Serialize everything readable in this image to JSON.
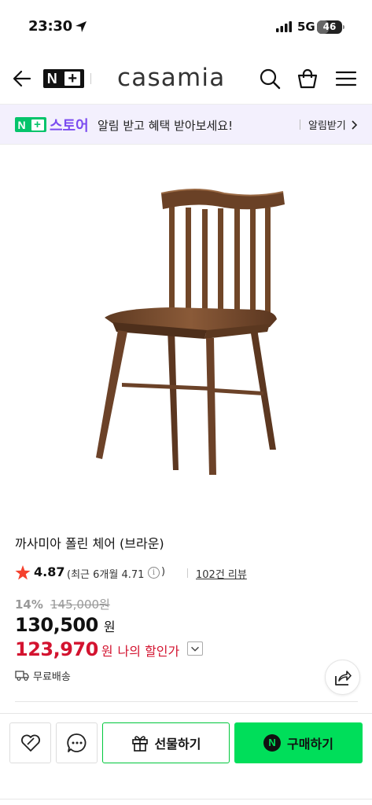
{
  "status_bar": {
    "time": "23:30",
    "network": "5G",
    "battery": "46",
    "battery_level_percent": 46
  },
  "header": {
    "logo_n": "N",
    "logo_plus": "+",
    "brand": "casamia",
    "icons": [
      "back-arrow-icon",
      "search-icon",
      "shopping-bag-icon",
      "menu-icon"
    ]
  },
  "promo": {
    "badge_n": "N",
    "badge_plus": "+",
    "store": "스토어",
    "text": "알림 받고 혜택 받아보세요!",
    "link": "알림받기"
  },
  "product": {
    "title": "까사미아 폴린 체어 (브라운)",
    "rating": "4.87",
    "recent_rating": "(최근 6개월 4.71",
    "recent_close": ")",
    "reviews": "102건 리뷰",
    "discount": "14%",
    "original_price": "145,000원",
    "price": "130,500",
    "price_unit": "원",
    "my_price": "123,970",
    "my_price_unit": "원",
    "my_price_label": "나의 할인가",
    "shipping": "무료배송"
  },
  "bottom_bar": {
    "gift_label": "선물하기",
    "buy_n": "N",
    "buy_label": "구매하기"
  },
  "colors": {
    "accent_green": "#00de5a",
    "nplus_green": "#05c46b",
    "store_purple": "#7b4bf0",
    "sale_red": "#d3132f",
    "star_red": "#f5412d",
    "promo_bg": "#f3f0fd"
  }
}
